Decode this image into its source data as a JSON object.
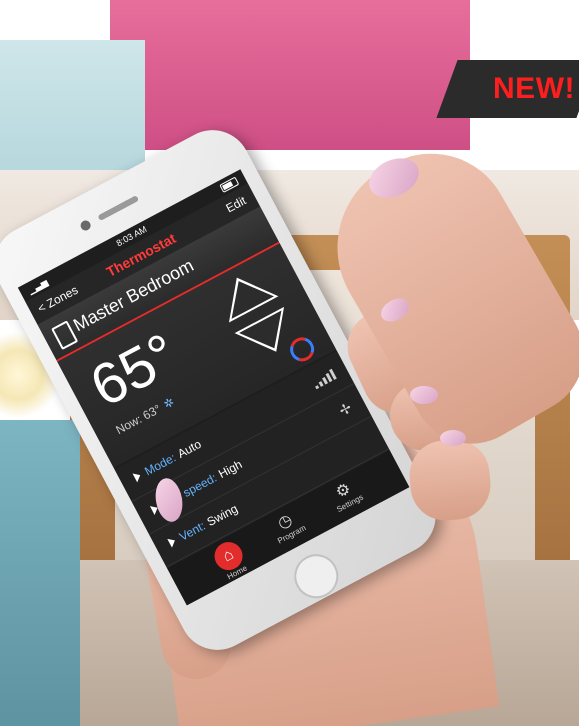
{
  "badge": {
    "text": "NEW!"
  },
  "phone_screen": {
    "status": {
      "time": "8:03 AM"
    },
    "nav": {
      "back": "< Zones",
      "title": "Thermostat",
      "edit": "Edit"
    },
    "room": {
      "name": "Master Bedroom"
    },
    "temperature": {
      "set_point": "65°",
      "now_label": "Now:",
      "now_value": "63°",
      "mode_icon": "snowflake-icon"
    },
    "settings": [
      {
        "label": "Mode:",
        "value": "Auto",
        "icon": "signal-bars-icon"
      },
      {
        "label": "Fan speed:",
        "value": "High",
        "icon": "fan-icon"
      },
      {
        "label": "Vent:",
        "value": "Swing",
        "icon": ""
      }
    ],
    "tabs": [
      {
        "label": "Home",
        "icon": "home-icon"
      },
      {
        "label": "Program",
        "icon": "timer-icon"
      },
      {
        "label": "Settings",
        "icon": "gear-icon"
      }
    ]
  },
  "colors": {
    "accent_red": "#e32d2d",
    "setting_blue": "#64b3ff",
    "badge_red": "#ff1e1e"
  }
}
